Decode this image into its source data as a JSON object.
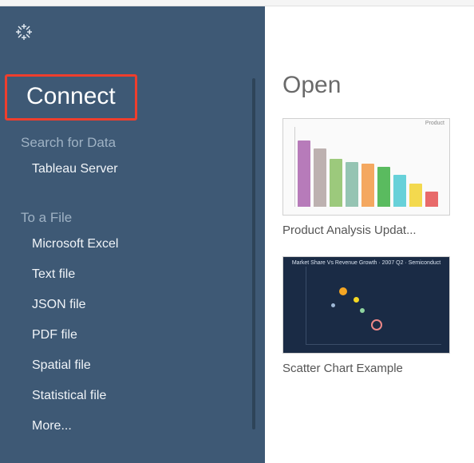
{
  "sidebar": {
    "heading": "Connect",
    "search_section_label": "Search for Data",
    "search_items": [
      {
        "label": "Tableau Server"
      }
    ],
    "file_section_label": "To a File",
    "file_items": [
      {
        "label": "Microsoft Excel"
      },
      {
        "label": "Text file"
      },
      {
        "label": "JSON file"
      },
      {
        "label": "PDF file"
      },
      {
        "label": "Spatial file"
      },
      {
        "label": "Statistical file"
      },
      {
        "label": "More..."
      }
    ]
  },
  "content": {
    "heading": "Open",
    "workbooks": [
      {
        "label": "Product Analysis Updat...",
        "thumb_type": "bar"
      },
      {
        "label": "Scatter Chart Example",
        "thumb_type": "scatter"
      }
    ]
  },
  "colors": {
    "sidebar_bg": "#3e5975",
    "highlight_border": "#ef3e2d"
  }
}
